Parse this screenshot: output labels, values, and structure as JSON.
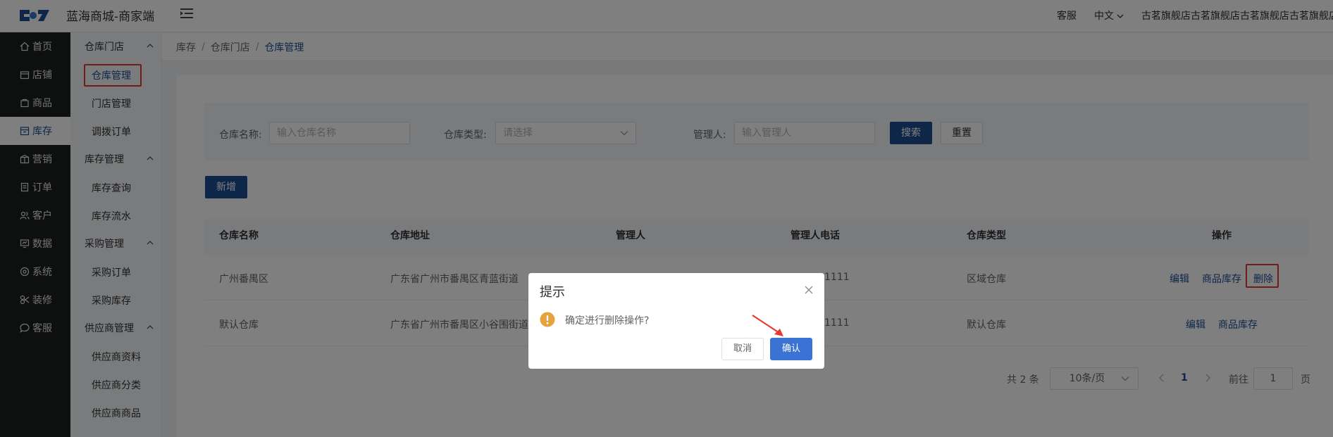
{
  "header": {
    "app_title": "蓝海商城-商家端",
    "service": "客服",
    "language": "中文",
    "store_name": "古茗旗舰店古茗旗舰店古茗旗舰店古茗旗舰店"
  },
  "main_nav": [
    {
      "label": "首页",
      "icon": "home-icon"
    },
    {
      "label": "店铺",
      "icon": "shop-icon"
    },
    {
      "label": "商品",
      "icon": "goods-icon"
    },
    {
      "label": "库存",
      "icon": "inventory-icon"
    },
    {
      "label": "营销",
      "icon": "marketing-icon"
    },
    {
      "label": "订单",
      "icon": "order-icon"
    },
    {
      "label": "客户",
      "icon": "customer-icon"
    },
    {
      "label": "数据",
      "icon": "data-icon"
    },
    {
      "label": "系统",
      "icon": "system-icon"
    },
    {
      "label": "装修",
      "icon": "decoration-icon"
    },
    {
      "label": "客服",
      "icon": "chat-icon"
    }
  ],
  "sub_nav": {
    "groups": [
      {
        "title": "仓库门店",
        "items": [
          "仓库管理",
          "门店管理",
          "调拨订单"
        ]
      },
      {
        "title": "库存管理",
        "items": [
          "库存查询",
          "库存流水"
        ]
      },
      {
        "title": "采购管理",
        "items": [
          "采购订单",
          "采购库存"
        ]
      },
      {
        "title": "供应商管理",
        "items": [
          "供应商资料",
          "供应商分类",
          "供应商商品"
        ]
      }
    ]
  },
  "breadcrumb": [
    "库存",
    "仓库门店",
    "仓库管理"
  ],
  "filters": {
    "warehouse_name_label": "仓库名称:",
    "warehouse_name_placeholder": "输入仓库名称",
    "warehouse_type_label": "仓库类型:",
    "warehouse_type_placeholder": "请选择",
    "manager_label": "管理人:",
    "manager_placeholder": "输入管理人",
    "search_button": "搜索",
    "reset_button": "重置"
  },
  "add_button": "新增",
  "table": {
    "columns": [
      "仓库名称",
      "仓库地址",
      "管理人",
      "管理人电话",
      "仓库类型",
      "操作"
    ],
    "rows": [
      {
        "name": "广州番禺区",
        "address": "广东省广州市番禺区青蓝街道",
        "phone": "1111",
        "type": "区域仓库",
        "actions": [
          "编辑",
          "商品库存",
          "删除"
        ]
      },
      {
        "name": "默认仓库",
        "address": "广东省广州市番禺区小谷围街道",
        "phone": "1111",
        "type": "默认仓库",
        "actions": [
          "编辑",
          "商品库存"
        ]
      }
    ]
  },
  "pagination": {
    "total": "共 2 条",
    "page_size": "10条/页",
    "current_page": "1",
    "goto_label": "前往",
    "goto_value": "1",
    "page_suffix": "页"
  },
  "dialog": {
    "title": "提示",
    "message": "确定进行删除操作?",
    "cancel": "取消",
    "confirm": "确认"
  },
  "colors": {
    "primary": "#1d4f91",
    "sidebar": "#1d1e1f",
    "highlight": "#e53935",
    "warning": "#e6a23c",
    "confirm": "#3a73d4"
  }
}
